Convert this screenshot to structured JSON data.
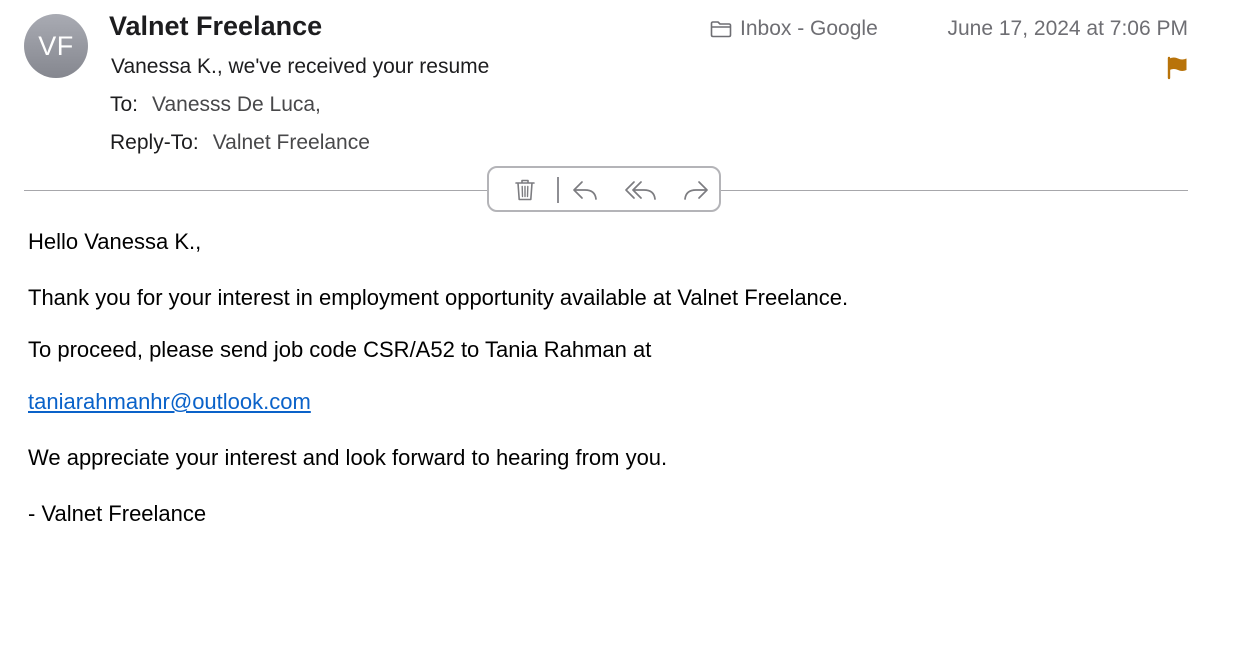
{
  "header": {
    "avatar_initials": "VF",
    "sender_name": "Valnet Freelance",
    "mailbox": "Inbox - Google",
    "date": "June 17, 2024 at 7:06 PM",
    "subject": "Vanessa K., we've received your resume",
    "to_label": "To:",
    "to_value": "Vanesss De Luca,",
    "reply_to_label": "Reply-To:",
    "reply_to_value": "Valnet Freelance",
    "flag_color": "#b8730a",
    "avatar_color": "#989aa2"
  },
  "toolbar": {
    "icons": [
      "trash-icon",
      "reply-icon",
      "reply-all-icon",
      "forward-icon"
    ]
  },
  "message": {
    "greeting": "Hello Vanessa K.,",
    "line1": "Thank you for your interest in employment opportunity available at Valnet Freelance.",
    "line2": "To proceed, please send job code CSR/A52 to Tania Rahman at",
    "email_link": "taniarahmanhr@outlook.com",
    "line3": "We appreciate your interest and look forward to hearing from you.",
    "signature": "- Valnet Freelance",
    "link_color": "#0a62c9"
  }
}
